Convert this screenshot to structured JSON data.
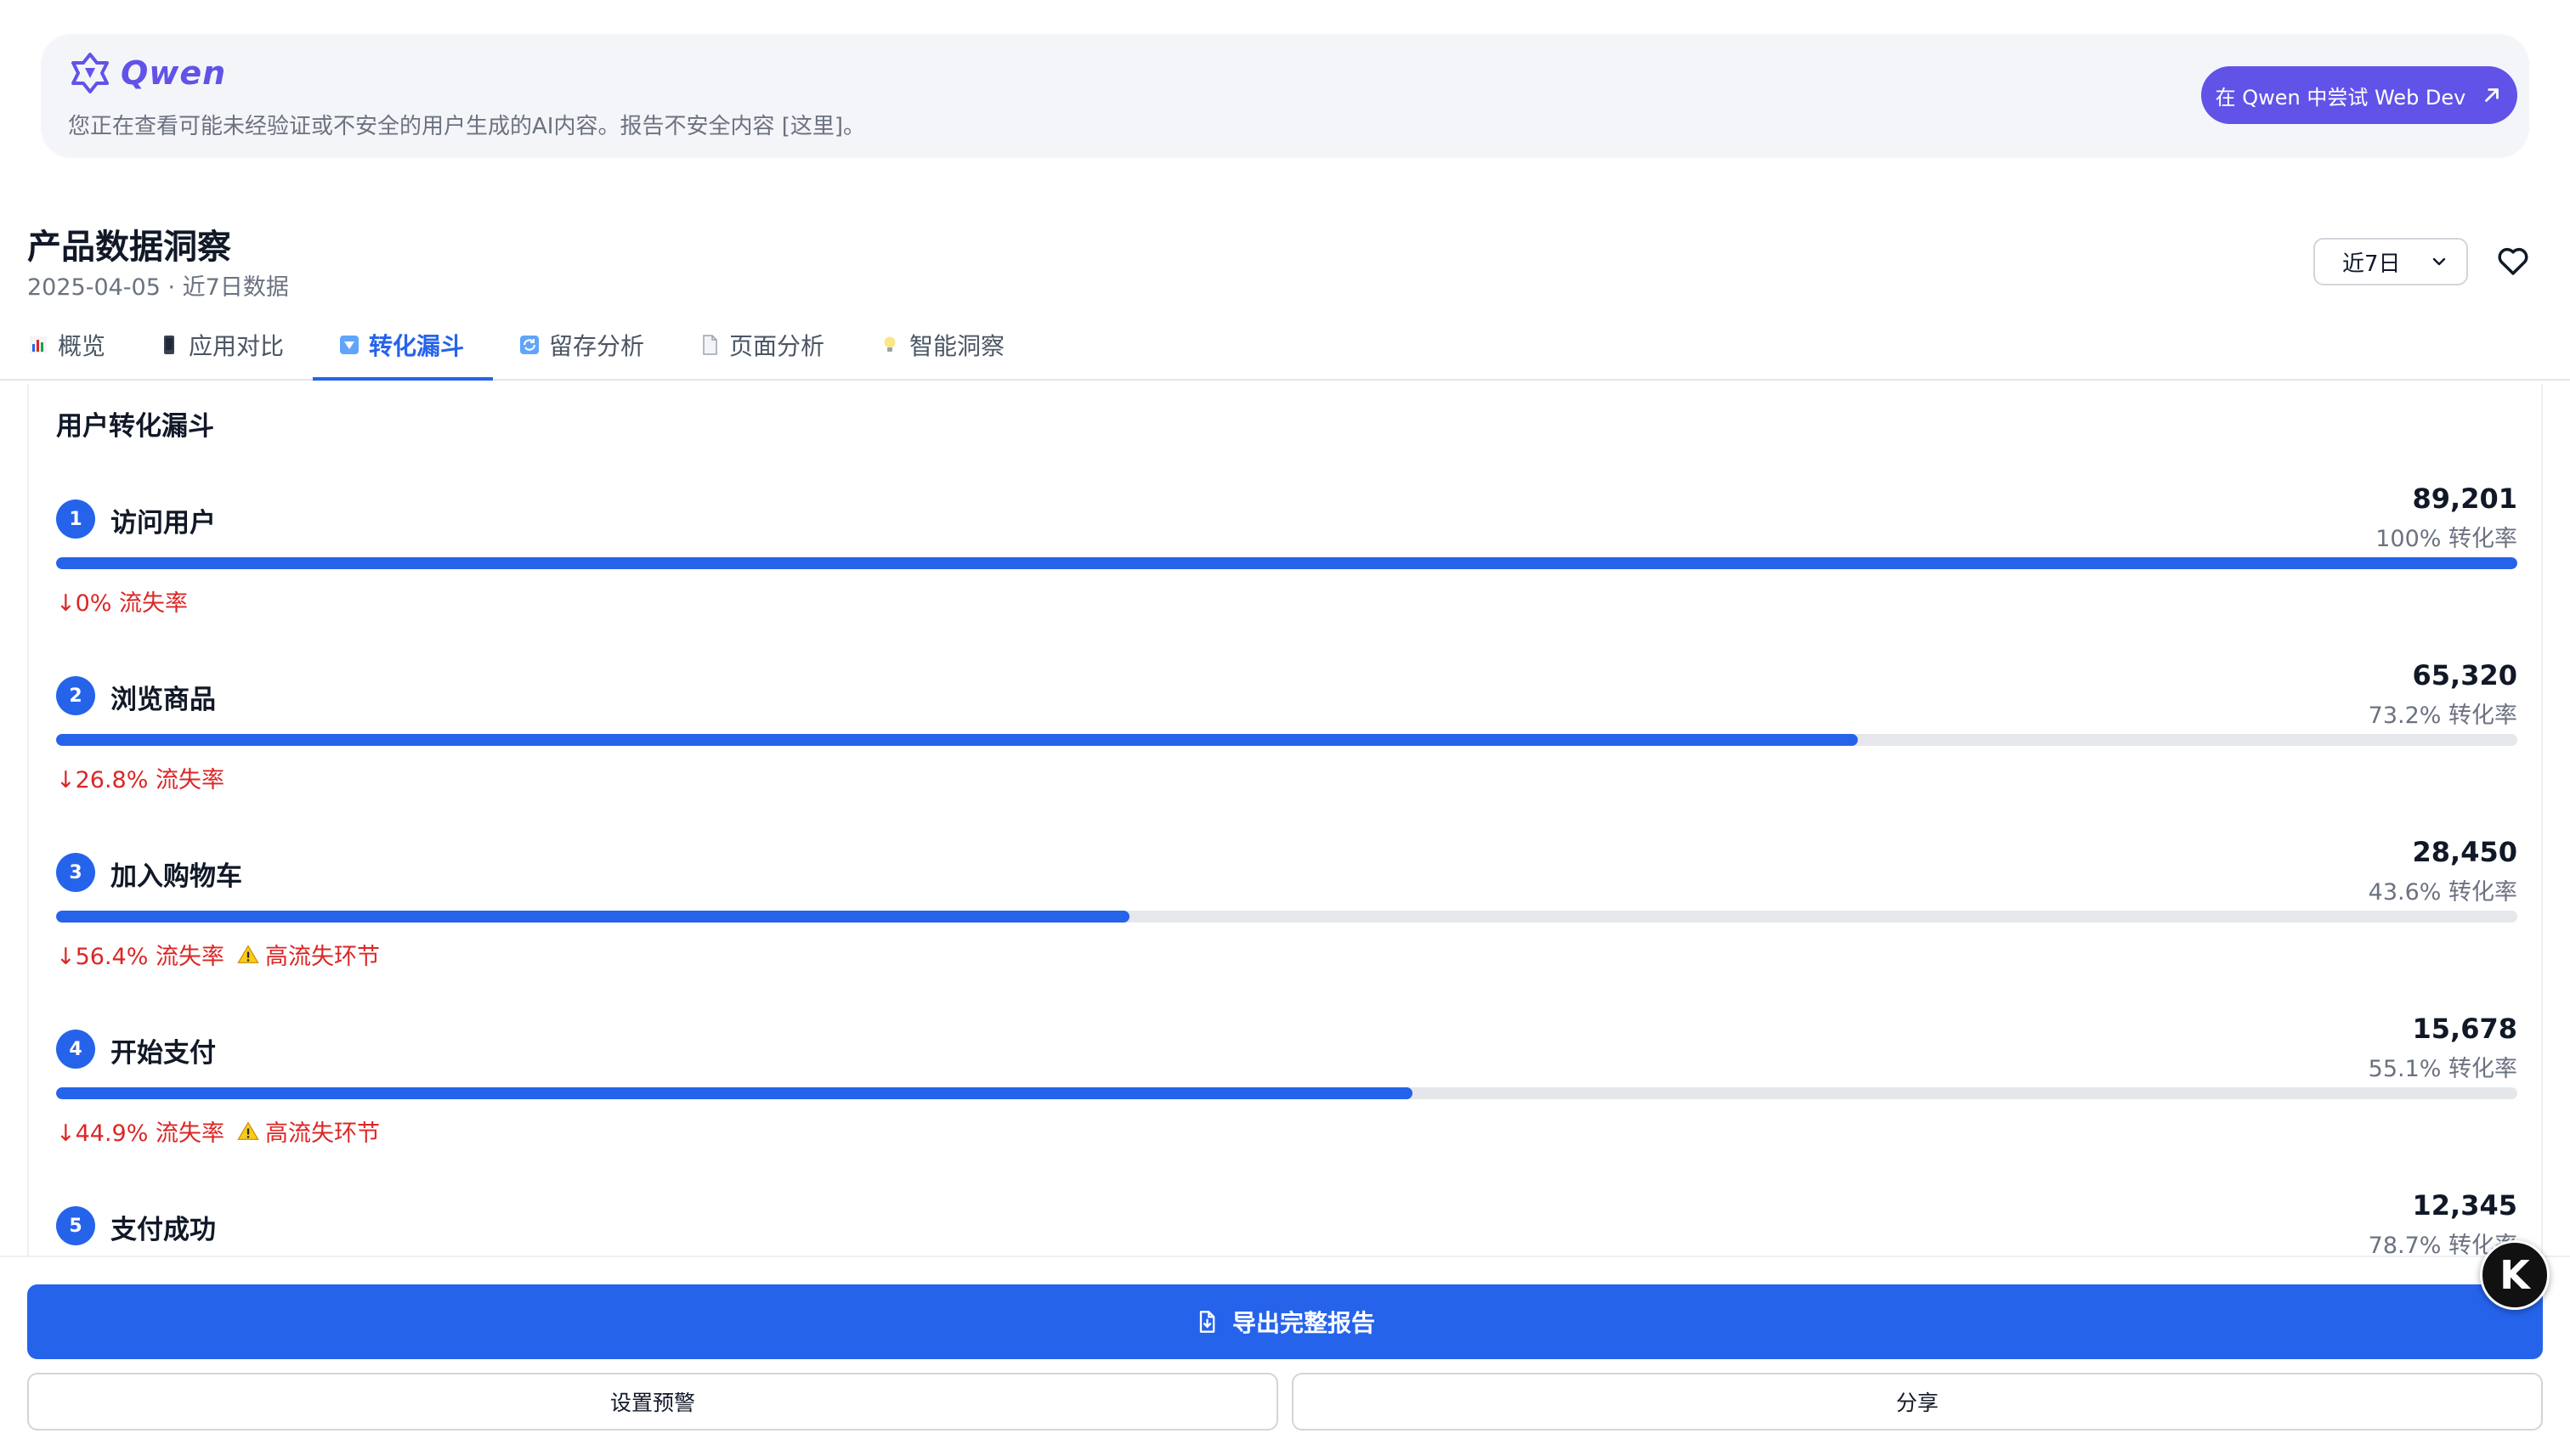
{
  "banner": {
    "brand": "Qwen",
    "message": "您正在查看可能未经验证或不安全的用户生成的AI内容。报告不安全内容 [这里]。",
    "cta": "在 Qwen 中尝试 Web Dev"
  },
  "header": {
    "title": "产品数据洞察",
    "subtitle": "2025-04-05 · 近7日数据",
    "range": "近7日"
  },
  "tabs": [
    {
      "label": "概览",
      "icon": "bar-chart-icon"
    },
    {
      "label": "应用对比",
      "icon": "phone-icon"
    },
    {
      "label": "转化漏斗",
      "icon": "down-arrow-box-icon",
      "active": true
    },
    {
      "label": "留存分析",
      "icon": "refresh-icon"
    },
    {
      "label": "页面分析",
      "icon": "document-icon"
    },
    {
      "label": "智能洞察",
      "icon": "lightbulb-icon"
    }
  ],
  "funnel": {
    "title": "用户转化漏斗",
    "steps": [
      {
        "num": "1",
        "name": "访问用户",
        "count": "89,201",
        "rate": "100% 转化率",
        "fill": 1.0,
        "drop": "↓0% 流失率",
        "warn": ""
      },
      {
        "num": "2",
        "name": "浏览商品",
        "count": "65,320",
        "rate": "73.2% 转化率",
        "fill": 0.732,
        "drop": "↓26.8% 流失率",
        "warn": ""
      },
      {
        "num": "3",
        "name": "加入购物车",
        "count": "28,450",
        "rate": "43.6% 转化率",
        "fill": 0.436,
        "drop": "↓56.4% 流失率",
        "warn": "高流失环节"
      },
      {
        "num": "4",
        "name": "开始支付",
        "count": "15,678",
        "rate": "55.1% 转化率",
        "fill": 0.551,
        "drop": "↓44.9% 流失率",
        "warn": "高流失环节"
      },
      {
        "num": "5",
        "name": "支付成功",
        "count": "12,345",
        "rate": "78.7% 转化率",
        "fill": 0.787,
        "drop": "",
        "warn": ""
      }
    ]
  },
  "actions": {
    "export": "导出完整报告",
    "alert": "设置预警",
    "share": "分享"
  },
  "floating": {
    "label": "K"
  },
  "colors": {
    "primary": "#2563eb",
    "brand": "#6153e8",
    "danger": "#dc2626"
  }
}
